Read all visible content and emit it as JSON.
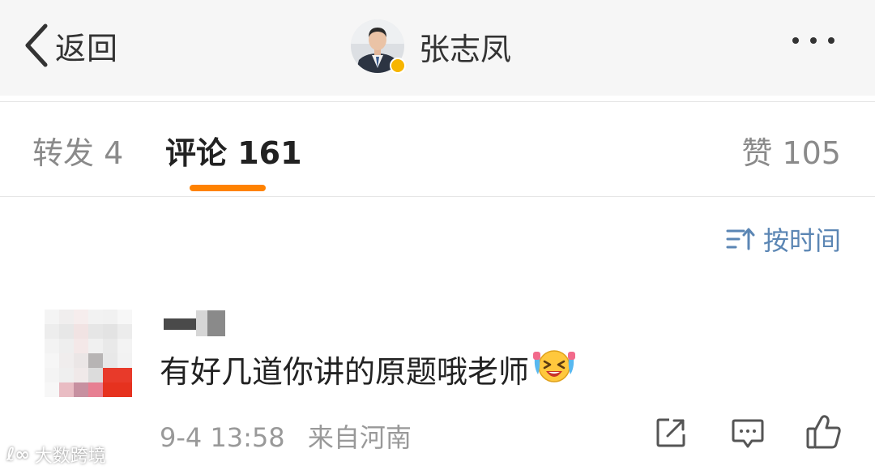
{
  "header": {
    "back_label": "返回",
    "title": "张志凤"
  },
  "tabs": {
    "repost": "转发 4",
    "comment": "评论 161",
    "like": "赞 105"
  },
  "sort": {
    "label": "按时间"
  },
  "comment": {
    "text": "有好几道你讲的原题哦老师",
    "emoji": "laughing-tears-emoji",
    "time": "9-4 13:58",
    "source": "来自河南"
  },
  "watermark": {
    "text": "大数跨境"
  },
  "colors": {
    "accent": "#ff8200",
    "link": "#5b86b4",
    "verified": "#f7b500"
  },
  "icons": {
    "back": "chevron-left-icon",
    "more": "more-dots-icon",
    "sort": "sort-icon",
    "share": "share-icon",
    "reply": "comment-icon",
    "like": "thumbs-up-icon"
  }
}
